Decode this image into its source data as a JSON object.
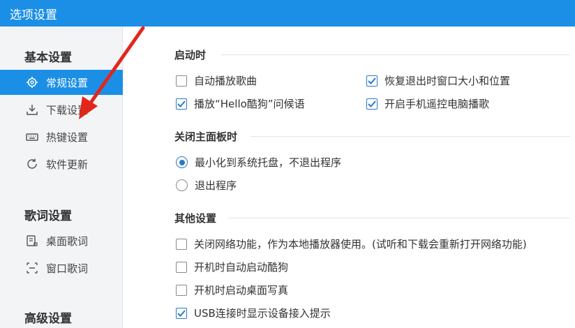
{
  "window": {
    "title": "选项设置"
  },
  "sidebar": {
    "groups": [
      {
        "title": "基本设置"
      },
      {
        "title": "歌词设置"
      },
      {
        "title": "高级设置"
      }
    ],
    "items": [
      {
        "label": "常规设置",
        "icon": "gear-icon",
        "active": true
      },
      {
        "label": "下载设置",
        "icon": "download-icon",
        "active": false
      },
      {
        "label": "热键设置",
        "icon": "keyboard-icon",
        "active": false
      },
      {
        "label": "软件更新",
        "icon": "update-icon",
        "active": false
      },
      {
        "label": "桌面歌词",
        "icon": "desktop-lyrics-icon",
        "active": false
      },
      {
        "label": "窗口歌词",
        "icon": "window-lyrics-icon",
        "active": false
      }
    ]
  },
  "sections": {
    "startup": {
      "title": "启动时",
      "options": [
        {
          "label": "自动播放歌曲",
          "checked": false
        },
        {
          "label": "恢复退出时窗口大小和位置",
          "checked": true
        },
        {
          "label": "播放“Hello酷狗”问候语",
          "checked": true
        },
        {
          "label": "开启手机遥控电脑播歌",
          "checked": true
        }
      ]
    },
    "close_panel": {
      "title": "关闭主面板时",
      "options": [
        {
          "label": "最小化到系统托盘，不退出程序",
          "selected": true
        },
        {
          "label": "退出程序",
          "selected": false
        }
      ]
    },
    "other": {
      "title": "其他设置",
      "options": [
        {
          "label": "关闭网络功能，作为本地播放器使用。(试听和下载会重新打开网络功能)",
          "checked": false
        },
        {
          "label": "开机时自动启动酷狗",
          "checked": false
        },
        {
          "label": "开机时启动桌面写真",
          "checked": false
        },
        {
          "label": "USB连接时显示设备接入提示",
          "checked": true
        }
      ]
    }
  },
  "colors": {
    "accent": "#1b8fe5",
    "annotation_arrow": "#e2261c",
    "check": "#2b78c9"
  }
}
